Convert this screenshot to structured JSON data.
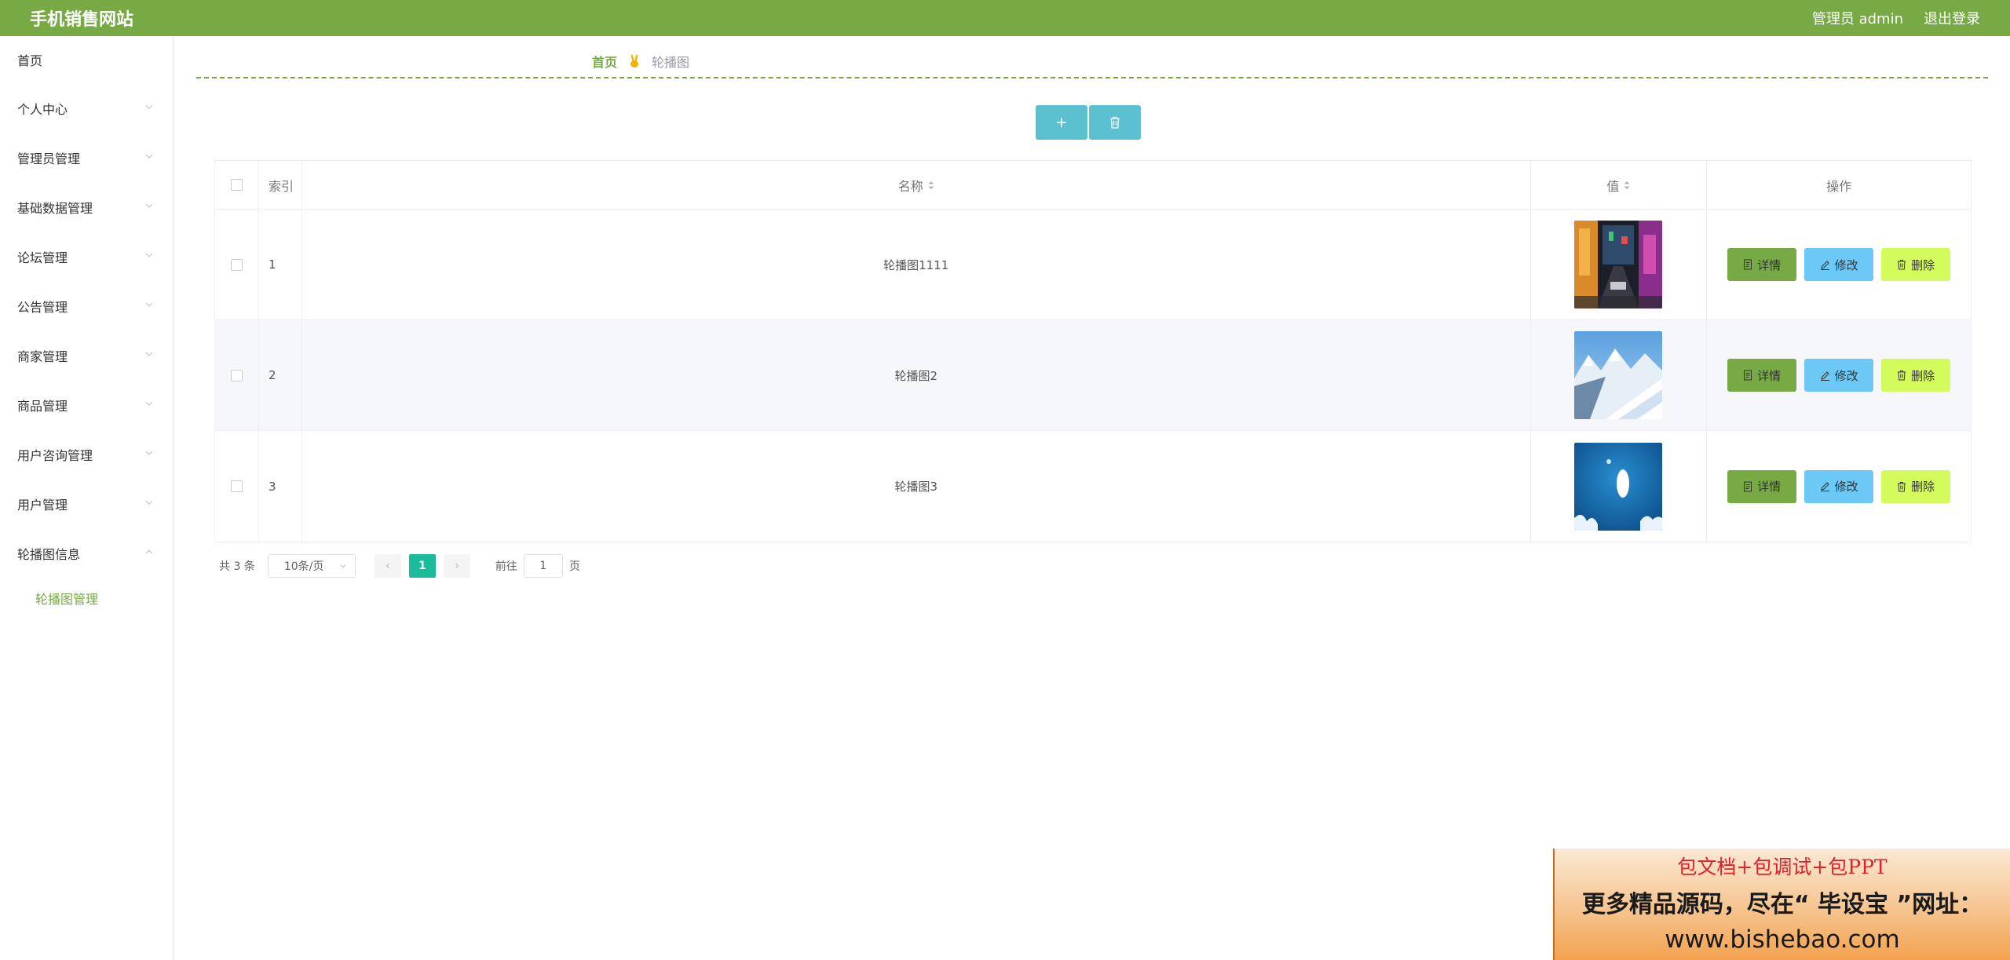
{
  "header": {
    "title": "手机销售网站",
    "admin_label": "管理员 admin",
    "logout_label": "退出登录",
    "bar_color": "#77aa44"
  },
  "sidebar": {
    "items": [
      {
        "label": "首页",
        "expandable": false
      },
      {
        "label": "个人中心",
        "expandable": true
      },
      {
        "label": "管理员管理",
        "expandable": true
      },
      {
        "label": "基础数据管理",
        "expandable": true
      },
      {
        "label": "论坛管理",
        "expandable": true
      },
      {
        "label": "公告管理",
        "expandable": true
      },
      {
        "label": "商家管理",
        "expandable": true
      },
      {
        "label": "商品管理",
        "expandable": true
      },
      {
        "label": "用户咨询管理",
        "expandable": true
      },
      {
        "label": "用户管理",
        "expandable": true
      },
      {
        "label": "轮播图信息",
        "expandable": true,
        "expanded": true
      }
    ],
    "submenu": {
      "label": "轮播图管理"
    }
  },
  "breadcrumb": {
    "home": "首页",
    "current": "轮播图",
    "separator_icon": "hand-peace-icon"
  },
  "toolbar": {
    "add_icon": "plus-icon",
    "delete_icon": "trash-icon"
  },
  "table": {
    "columns": {
      "index": "索引",
      "name": "名称",
      "value": "值",
      "ops": "操作"
    },
    "rows": [
      {
        "index": "1",
        "name": "轮播图1111",
        "image": "city-street-night-thumbnail"
      },
      {
        "index": "2",
        "name": "轮播图2",
        "image": "snowy-mountain-thumbnail"
      },
      {
        "index": "3",
        "name": "轮播图3",
        "image": "blue-water-thumbnail"
      }
    ],
    "ops": {
      "detail": "详情",
      "edit": "修改",
      "delete": "删除"
    }
  },
  "pagination": {
    "total": "共 3 条",
    "page_size": "10条/页",
    "current_page": "1",
    "goto_label": "前往",
    "goto_value": "1",
    "page_suffix": "页"
  },
  "ad": {
    "line1": "包文档+包调试+包PPT",
    "line2": "更多精品源码，尽在“ 毕设宝 ”网址：",
    "line3": "www.bishebao.com"
  }
}
